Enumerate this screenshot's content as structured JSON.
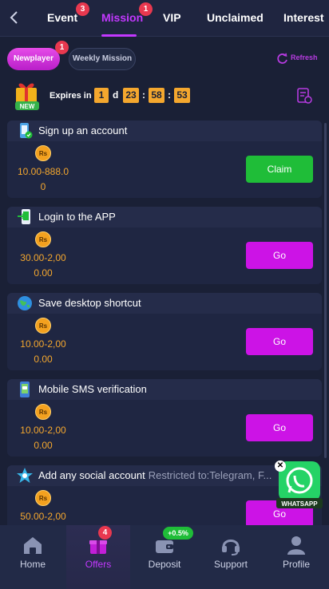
{
  "header": {
    "tabs": [
      {
        "label": "Event",
        "badge": "3"
      },
      {
        "label": "Mission",
        "badge": "1",
        "active": true
      },
      {
        "label": "VIP"
      },
      {
        "label": "Unclaimed"
      },
      {
        "label": "Interest"
      }
    ]
  },
  "subtabs": {
    "newplayer": "Newplayer",
    "newplayer_badge": "1",
    "weekly": "Weekly Mission",
    "refresh": "Refresh"
  },
  "timer": {
    "label": "Expires in",
    "days": "1",
    "day_unit": "d",
    "hours": "23",
    "minutes": "58",
    "seconds": "53",
    "gift_tag": "NEW"
  },
  "coin_symbol": "Rs",
  "missions": [
    {
      "title": "Sign up an account",
      "restrict": "",
      "amount_line1": "10.00-888.0",
      "amount_line2": "0",
      "button": "Claim",
      "icon": "phone-check-icon"
    },
    {
      "title": "Login to the APP",
      "restrict": "",
      "amount_line1": "30.00-2,00",
      "amount_line2": "0.00",
      "button": "Go",
      "icon": "phone-login-icon"
    },
    {
      "title": "Save desktop shortcut",
      "restrict": "",
      "amount_line1": "10.00-2,00",
      "amount_line2": "0.00",
      "button": "Go",
      "icon": "globe-icon"
    },
    {
      "title": "Mobile SMS verification",
      "restrict": "",
      "amount_line1": "10.00-2,00",
      "amount_line2": "0.00",
      "button": "Go",
      "icon": "phone-sms-icon"
    },
    {
      "title": "Add any social account",
      "restrict": "Restricted to:Telegram, F...",
      "amount_line1": "50.00-2,00",
      "amount_line2": "",
      "button": "Go",
      "icon": "social-icon"
    }
  ],
  "whatsapp": {
    "label": "WHATSAPP"
  },
  "nav": [
    {
      "label": "Home",
      "icon": "home-icon"
    },
    {
      "label": "Offers",
      "icon": "gift-icon",
      "badge": "4",
      "active": true
    },
    {
      "label": "Deposit",
      "icon": "wallet-icon",
      "badge": "+0.5%"
    },
    {
      "label": "Support",
      "icon": "headset-icon"
    },
    {
      "label": "Profile",
      "icon": "person-icon"
    }
  ],
  "colors": {
    "accent": "#c338ff",
    "claim": "#1fbd38",
    "go": "#cc13e6",
    "coin": "#f4a72e",
    "bg": "#1a2036"
  }
}
